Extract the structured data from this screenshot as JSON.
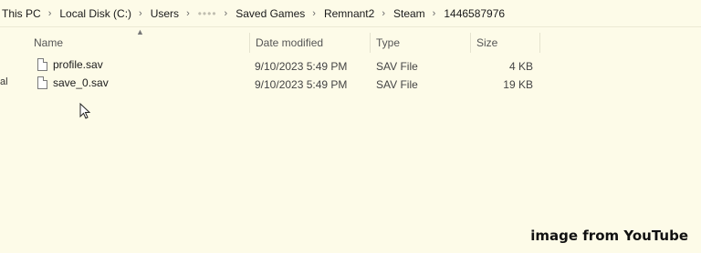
{
  "breadcrumb": [
    {
      "label": "This PC"
    },
    {
      "label": "Local Disk (C:)"
    },
    {
      "label": "Users"
    },
    {
      "label": "••••"
    },
    {
      "label": "Saved Games"
    },
    {
      "label": "Remnant2"
    },
    {
      "label": "Steam"
    },
    {
      "label": "1446587976"
    }
  ],
  "nav_fragment": "al",
  "columns": {
    "name": "Name",
    "date": "Date modified",
    "type": "Type",
    "size": "Size"
  },
  "files": [
    {
      "name": "profile.sav",
      "date": "9/10/2023 5:49 PM",
      "type": "SAV File",
      "size": "4 KB"
    },
    {
      "name": "save_0.sav",
      "date": "9/10/2023 5:49 PM",
      "type": "SAV File",
      "size": "19 KB"
    }
  ],
  "watermark": "image from YouTube"
}
